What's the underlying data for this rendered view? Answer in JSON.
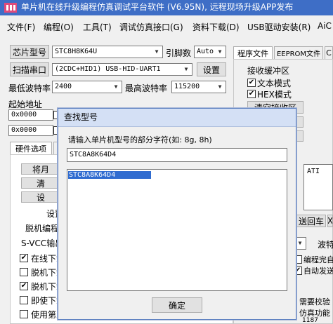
{
  "window": {
    "title": "单片机在线升级编程仿真调试平台软件 (V6.95N), 远程现场升级APP发布"
  },
  "menu": [
    "文件(F)",
    "编程(O)",
    "工具(T)",
    "调试仿真接口(G)",
    "资料下载(D)",
    "USB驱动安装(R)",
    "AiC"
  ],
  "left": {
    "chip_model_button": "芯片型号",
    "chip_model_value": "STC8H8K64U",
    "pin_count_label": "引脚数",
    "pin_count_value": "Auto",
    "scan_port_button": "扫描串口",
    "port_value": "(2CDC+HID1) USB-HID-UART1",
    "settings_button": "设置",
    "min_baud_label": "最低波特率",
    "min_baud_value": "2400",
    "max_baud_label": "最高波特率",
    "max_baud_value": "115200",
    "start_addr_label": "起始地址",
    "addr1_value": "0x0000",
    "addr2_value": "0x0000",
    "hw_options_tab": "硬件选项",
    "btn_partial_1": "将月",
    "btn_partial_2": "清",
    "btn_partial_3": "设",
    "text_set": "设置",
    "text_offline": "脱机编程",
    "text_svcc": "S-VCC输出",
    "check_online": "在线下载",
    "check_offline1": "脱机下载",
    "check_offline2": "脱机下载",
    "check_immediate": "即使下载",
    "check_use": "使用第三"
  },
  "right": {
    "tab_program_file": "程序文件",
    "tab_eeprom_file": "EEPROM文件",
    "tab_c": "C",
    "recv_buffer_label": "接收缓冲区",
    "check_text_mode": "文本模式",
    "check_hex_mode": "HEX模式",
    "clear_recv_button": "清空接收区",
    "frag_ati": "ATI",
    "send_button": "送回车",
    "frag_x": "X",
    "frag_bo": "波特",
    "check_auto_complete": "编程完自",
    "check_auto_send": "自动发送",
    "frag_need_verify": "需要校验",
    "frag_emu_func": "仿真功能",
    "frag_bottom": "1187"
  },
  "dialog": {
    "title": "查找型号",
    "prompt": "请输入单片机型号的部分字符(如: 8g, 8h)",
    "input_value": "STC8A8K64D4",
    "result_selected": "STC8A8K64D4",
    "ok_button": "确定"
  },
  "colors": {
    "titlebar": "#3e6ec6",
    "selection": "#2f6bd0",
    "dialog_title": "#d4e0f5"
  }
}
